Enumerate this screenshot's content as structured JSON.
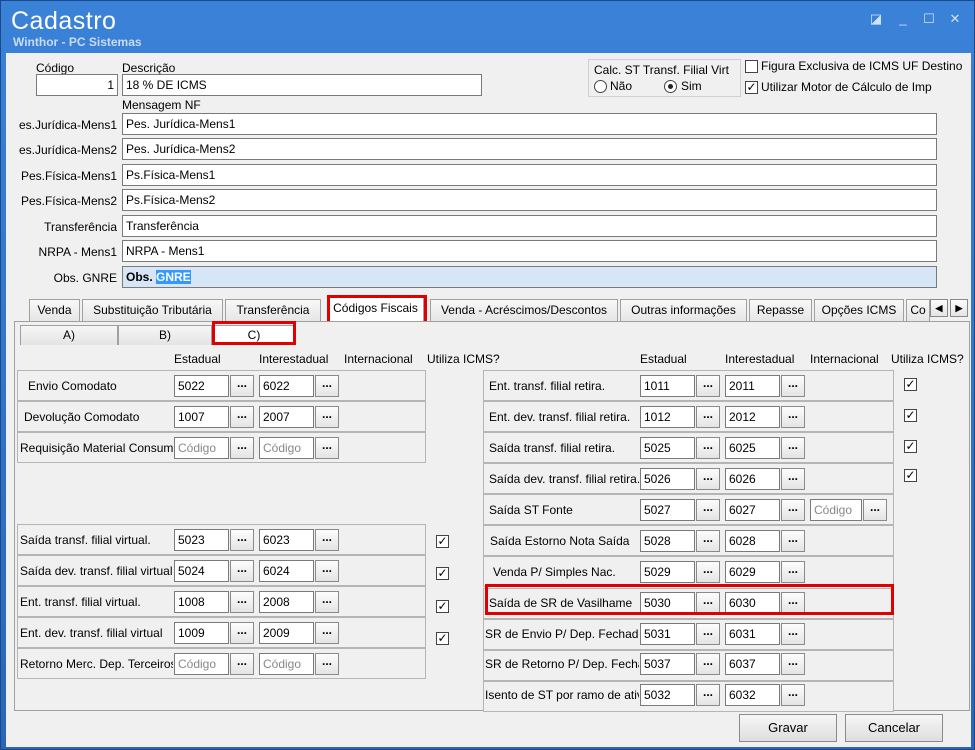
{
  "window": {
    "title": "Cadastro",
    "subtitle": "Winthor - PC Sistemas",
    "controls": [
      "◪",
      "_",
      "☐",
      "✕"
    ]
  },
  "header": {
    "codigo_label": "Código",
    "codigo_value": "1",
    "descricao_label": "Descrição",
    "descricao_value": "18 % DE ICMS",
    "calc_st_label": "Calc. ST Transf. Filial Virt",
    "radio_nao": "Não",
    "radio_sim": "Sim",
    "radio_selected": "Sim",
    "figura_label": "Figura Exclusiva de ICMS UF Destino",
    "figura_checked": false,
    "motor_label": "Utilizar Motor de Cálculo de Imp",
    "motor_checked": true,
    "mensagem_label": "Mensagem NF"
  },
  "messages": [
    {
      "label": "es.Jurídica-Mens1",
      "value": "Pes. Jurídica-Mens1"
    },
    {
      "label": "es.Jurídica-Mens2",
      "value": "Pes. Jurídica-Mens2"
    },
    {
      "label": "Pes.Física-Mens1",
      "value": "Ps.Física-Mens1"
    },
    {
      "label": "Pes.Física-Mens2",
      "value": "Ps.Física-Mens2"
    },
    {
      "label": "Transferência",
      "value": "Transferência"
    },
    {
      "label": "NRPA - Mens1",
      "value": "NRPA - Mens1"
    },
    {
      "label": "Obs. GNRE",
      "value_prefix": "Obs.",
      "value_selected": "GNRE"
    }
  ],
  "tabs": [
    "Venda",
    "Substituição Tributária",
    "Transferência",
    "Códigos Fiscais",
    "Venda - Acréscimos/Descontos",
    "Outras informações",
    "Repasse",
    "Opções ICMS",
    "Co"
  ],
  "active_tab": "Códigos Fiscais",
  "subtabs": [
    "A)",
    "B)",
    "C)"
  ],
  "active_subtab": "C)",
  "columns": {
    "estadual": "Estadual",
    "interestadual": "Interestadual",
    "internacional": "Internacional",
    "utiliza_icms": "Utiliza ICMS?"
  },
  "placeholder": "Código",
  "dots": "...",
  "left_rows": [
    {
      "label": "Envio Comodato",
      "estadual": "5022",
      "interestadual": "6022"
    },
    {
      "label": "Devolução Comodato",
      "estadual": "1007",
      "interestadual": "2007"
    },
    {
      "label": "Requisição Material Consumo",
      "estadual": "",
      "interestadual": ""
    },
    {
      "label": "Saída transf. filial virtual.",
      "estadual": "5023",
      "interestadual": "6023",
      "check": true
    },
    {
      "label": "Saída dev. transf. filial virtual",
      "estadual": "5024",
      "interestadual": "6024",
      "check": true
    },
    {
      "label": "Ent. transf. filial virtual.",
      "estadual": "1008",
      "interestadual": "2008",
      "check": true
    },
    {
      "label": "Ent. dev. transf. filial virtual",
      "estadual": "1009",
      "interestadual": "2009",
      "check": true
    },
    {
      "label": "Retorno Merc. Dep. Terceiros",
      "estadual": "",
      "interestadual": ""
    }
  ],
  "right_rows": [
    {
      "label": "Ent. transf. filial retira.",
      "estadual": "1011",
      "interestadual": "2011",
      "check": true
    },
    {
      "label": "Ent. dev. transf. filial retira.",
      "estadual": "1012",
      "interestadual": "2012",
      "check": true
    },
    {
      "label": "Saída transf. filial retira.",
      "estadual": "5025",
      "interestadual": "6025",
      "check": true
    },
    {
      "label": "Saída dev. transf. filial retira.",
      "estadual": "5026",
      "interestadual": "6026",
      "check": true
    },
    {
      "label": "Saída ST Fonte",
      "estadual": "5027",
      "interestadual": "6027",
      "internacional": ""
    },
    {
      "label": "Saída Estorno Nota Saída",
      "estadual": "5028",
      "interestadual": "6028"
    },
    {
      "label": "Venda P/ Simples Nac.",
      "estadual": "5029",
      "interestadual": "6029"
    },
    {
      "label": "Saída de SR de Vasilhame",
      "estadual": "5030",
      "interestadual": "6030"
    },
    {
      "label": "SR de Envio P/ Dep. Fechado",
      "estadual": "5031",
      "interestadual": "6031"
    },
    {
      "label": "SR de Retorno P/ Dep. Fechado",
      "estadual": "5037",
      "interestadual": "6037"
    },
    {
      "label": "Isento de ST por ramo de ativ.",
      "estadual": "5032",
      "interestadual": "6032"
    }
  ],
  "buttons": {
    "gravar": "Gravar",
    "cancelar": "Cancelar"
  },
  "scroll_left": "◀",
  "scroll_right": "▶",
  "checkmark": "✓",
  "colors": {
    "title_bg": "#3a82d8",
    "highlight_red": "#e00000",
    "selection": "#3399ff"
  }
}
